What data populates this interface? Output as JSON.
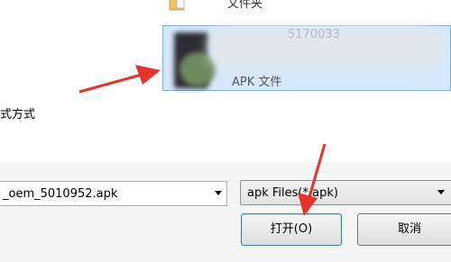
{
  "file_list": {
    "folder_label": "文件夹",
    "selected_item": {
      "name": "5170033",
      "type": "APK 文件"
    }
  },
  "left_label": "式方式",
  "filename_field": {
    "value": "_oem_5010952.apk"
  },
  "filetype_select": {
    "selected": "apk Files(*.apk)"
  },
  "buttons": {
    "open": "打开(O)",
    "cancel": "取消"
  },
  "colors": {
    "annotation_arrow": "#e8322b",
    "selection_fill": "#d5e8fb",
    "selection_border": "#84acdd"
  }
}
